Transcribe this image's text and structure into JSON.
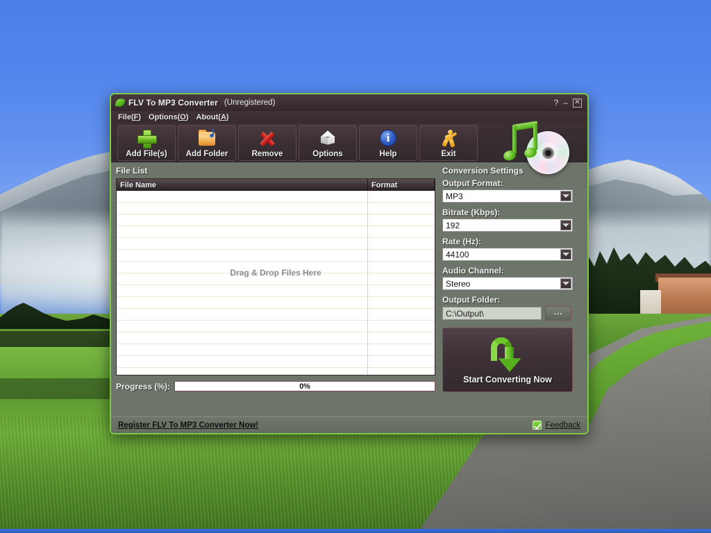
{
  "desktop": {
    "wallpaper_description": "mountain-landscape-with-gravel-path"
  },
  "window": {
    "title": "FLV To MP3 Converter",
    "subtitle": "(Unregistered)",
    "logo_icon": "green-leaf-icon",
    "controls": {
      "help": "?",
      "minimize": "–",
      "close": "✕"
    }
  },
  "menubar": {
    "items": [
      {
        "label": "File",
        "accel": "F",
        "name": "menu-file"
      },
      {
        "label": "Options",
        "accel": "O",
        "name": "menu-options"
      },
      {
        "label": "About",
        "accel": "A",
        "name": "menu-about"
      }
    ]
  },
  "toolbar": {
    "buttons": [
      {
        "label": "Add File(s)",
        "icon": "plus-icon"
      },
      {
        "label": "Add Folder",
        "icon": "folder-music-icon"
      },
      {
        "label": "Remove",
        "icon": "red-x-icon"
      },
      {
        "label": "Options",
        "icon": "cube-icon"
      },
      {
        "label": "Help",
        "icon": "info-circle-icon"
      },
      {
        "label": "Exit",
        "icon": "running-man-icon"
      }
    ],
    "brand_icon": "music-notes-cd-icon"
  },
  "file_list": {
    "title": "File List",
    "columns": [
      "File Name",
      "Format"
    ],
    "rows": [],
    "empty_message": "Drag & Drop Files Here"
  },
  "progress": {
    "label": "Progress (%):",
    "value_text": "0%",
    "percent": 0
  },
  "settings": {
    "title": "Conversion Settings",
    "fields": [
      {
        "label": "Output Format:",
        "value": "MP3",
        "name": "output-format"
      },
      {
        "label": "Bitrate (Kbps):",
        "value": "192",
        "name": "bitrate"
      },
      {
        "label": "Rate (Hz):",
        "value": "44100",
        "name": "rate"
      },
      {
        "label": "Audio Channel:",
        "value": "Stereo",
        "name": "audio-channel"
      }
    ],
    "output_folder": {
      "label": "Output Folder:",
      "value": "C:\\Output\\",
      "browse_label": "..."
    },
    "start_button": {
      "label": "Start Converting Now",
      "icon": "green-download-arrow-icon"
    }
  },
  "statusbar": {
    "register_link": "Register FLV To MP3 Converter Now!",
    "feedback_link": "Feedback",
    "feedback_icon": "green-check-icon"
  },
  "colors": {
    "accent_green": "#7ec943",
    "window_chrome": "#3a2f33",
    "panel": "#6d7469",
    "desktop_sky": "#4a7fe8"
  }
}
